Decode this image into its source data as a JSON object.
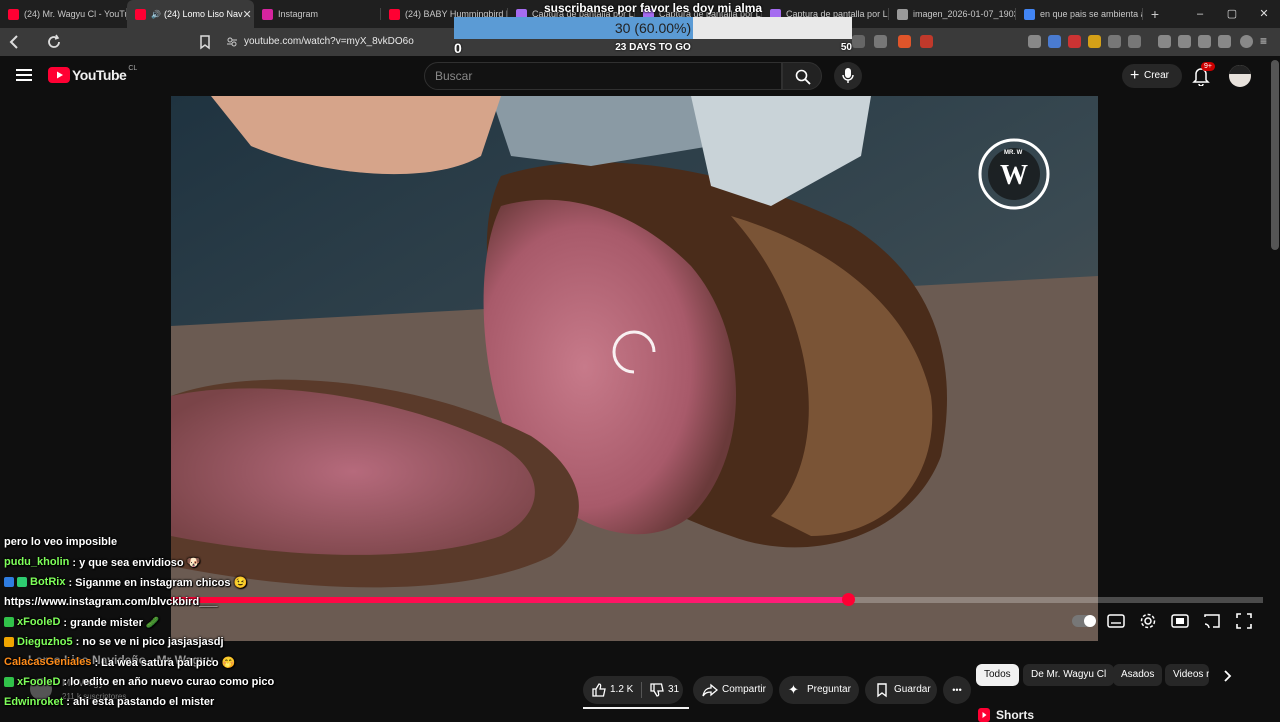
{
  "browser": {
    "tabs": [
      {
        "title": "(24) Mr. Wagyu Cl - YouTub",
        "favicon_color": "#ff0033",
        "active": false
      },
      {
        "title": "(24) Lomo Liso Nav",
        "favicon_color": "#ff0033",
        "active": true,
        "audio_icon": "speaker-icon"
      },
      {
        "title": "Instagram",
        "favicon_color": "#d6249f",
        "active": false
      },
      {
        "title": "(24) BABY Hummingbird F",
        "favicon_color": "#ff0033",
        "active": false
      },
      {
        "title": "Captura de pantalla por L",
        "favicon_color": "#a56cf0",
        "active": false
      },
      {
        "title": "Captura de pantalla por L",
        "favicon_color": "#a56cf0",
        "active": false
      },
      {
        "title": "Captura de pantalla por L",
        "favicon_color": "#a56cf0",
        "active": false
      },
      {
        "title": "imagen_2026-01-07_1903",
        "favicon_color": "#9a9a9a",
        "active": false
      },
      {
        "title": "en que pais se ambienta a",
        "favicon_color": "#4285f4",
        "active": false
      }
    ],
    "new_tab": "+",
    "window_controls": [
      "–",
      "▢",
      "✕"
    ],
    "url": "youtube.com/watch?v=myX_8vkDO6o"
  },
  "goal_overlay": {
    "title": "suscribanse por favor les doy mi alma",
    "progress_text": "30 (60.00%)",
    "progress_fraction": 0.6,
    "min": "0",
    "max": "50",
    "days_left": "23 DAYS TO GO"
  },
  "youtube": {
    "logo_text": "YouTube",
    "country": "CL",
    "search_placeholder": "Buscar",
    "create_label": "Crear",
    "notifications_badge": "9+",
    "video": {
      "watermark": "MR. W",
      "progress_fraction": 0.62,
      "loading": true
    },
    "title": "Lomo Liso Navideño - Mr Wagyu",
    "channel": "Mr. Wagyu Cl",
    "subscribers": "211 k suscriptores",
    "actions": {
      "likes": "1.2 K",
      "dislikes": "31",
      "share": "Compartir",
      "ask": "Preguntar",
      "save": "Guardar",
      "more": "•••"
    },
    "chips": [
      "Todos",
      "De Mr. Wagyu Cl",
      "Asados",
      "Videos r"
    ],
    "shorts_label": "Shorts"
  },
  "chat": [
    {
      "user": "",
      "text": "pero lo veo imposible",
      "color": "#ffffff",
      "badges": []
    },
    {
      "user": "pudu_kholin",
      "text": ": y que sea envidioso 🐶",
      "color": "#7fff5a",
      "badges": []
    },
    {
      "user": "BotRix",
      "text": ": Siganme en instagram chicos 😉",
      "color": "#7fff5a",
      "badges": [
        "#2f7de1",
        "#2ecc71"
      ]
    },
    {
      "user": "",
      "text": "https://www.instagram.com/blvckbird___",
      "color": "#ffffff",
      "badges": []
    },
    {
      "user": "xFooleD",
      "text": ": grande mister 🥒",
      "color": "#7fff5a",
      "badges": [
        "#31c24a"
      ]
    },
    {
      "user": "Dieguzho5",
      "text": ": no se ve ni pico jasjasjasdj",
      "color": "#7fff5a",
      "badges": [
        "#f0a500"
      ]
    },
    {
      "user": "CalacasGeniales",
      "text": ": La wea satura pal pico 🤭",
      "color": "#ff8c1a",
      "badges": []
    },
    {
      "user": "xFooleD",
      "text": ": lo edito en año nuevo curao como pico",
      "color": "#7fff5a",
      "badges": [
        "#31c24a"
      ]
    },
    {
      "user": "Edwinroket",
      "text": ": ahi esta pastando el mister",
      "color": "#7fff5a",
      "badges": []
    }
  ]
}
